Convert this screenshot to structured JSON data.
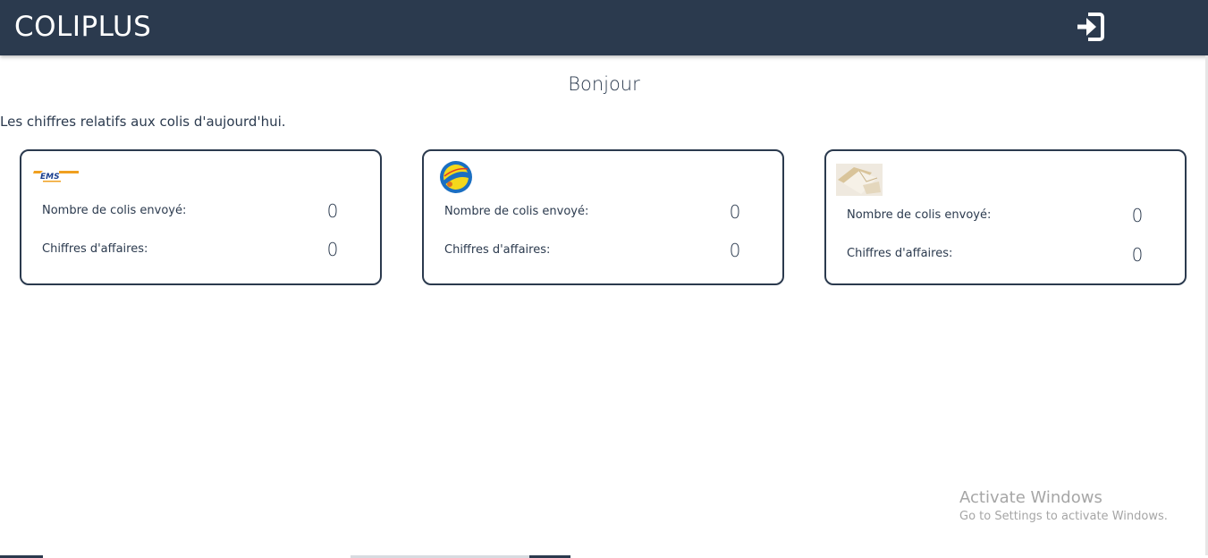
{
  "header": {
    "brand": "COLIPLUS",
    "login_icon": "sign-in-icon"
  },
  "main": {
    "greeting": "Bonjour",
    "intro": "Les chiffres relatifs aux colis d'aujourd'hui."
  },
  "cards": [
    {
      "logo": "ems-logo",
      "sent_label": "Nombre de colis envoyé:",
      "sent_value": "0",
      "revenue_label": "Chiffres d'affaires:",
      "revenue_value": "0"
    },
    {
      "logo": "amana-logo",
      "sent_label": "Nombre de colis envoyé:",
      "sent_value": "0",
      "revenue_label": "Chiffres d'affaires:",
      "revenue_value": "0"
    },
    {
      "logo": "envelopes-logo",
      "sent_label": "Nombre de colis envoyé:",
      "sent_value": "0",
      "revenue_label": "Chiffres d'affaires:",
      "revenue_value": "0"
    }
  ],
  "watermark": {
    "title": "Activate Windows",
    "subtitle": "Go to Settings to activate Windows."
  },
  "colors": {
    "primary": "#2b3a4e",
    "background": "#ffffff",
    "watermark": "#a6a6a6"
  }
}
